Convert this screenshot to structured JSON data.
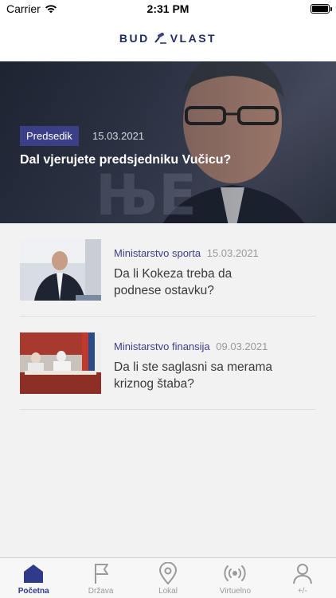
{
  "status_bar": {
    "carrier": "Carrier",
    "time": "2:31 PM"
  },
  "header": {
    "logo_left": "BUD",
    "logo_right": "VLAST"
  },
  "hero": {
    "category": "Predsedik",
    "date": "15.03.2021",
    "title": "Dal vjerujete predsjedniku Vučicu?"
  },
  "articles": [
    {
      "category": "Ministarstvo sporta",
      "date": "15.03.2021",
      "title": "Da li Kokeza treba da podnese ostavku?"
    },
    {
      "category": "Ministarstvo finansija",
      "date": "09.03.2021",
      "title": "Da li ste saglasni sa merama kriznog štaba?"
    }
  ],
  "tabs": [
    {
      "label": "Početna",
      "icon": "home-icon"
    },
    {
      "label": "Država",
      "icon": "flag-icon"
    },
    {
      "label": "Lokal",
      "icon": "location-pin-icon"
    },
    {
      "label": "Virtuelno",
      "icon": "broadcast-icon"
    },
    {
      "label": "+/-",
      "icon": "person-icon"
    }
  ],
  "colors": {
    "accent": "#3b3f88",
    "active_tab": "#2f3a8a",
    "inactive_tab": "#9a9a9a"
  }
}
